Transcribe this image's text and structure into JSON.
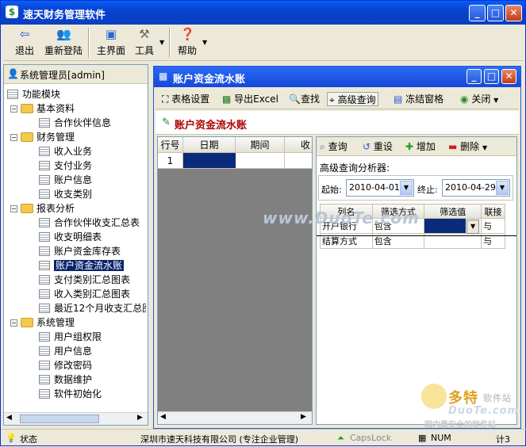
{
  "window": {
    "title": "速天财务管理软件"
  },
  "toolbar": {
    "exit": "退出",
    "relogin": "重新登陆",
    "main": "主界面",
    "tools": "工具",
    "help": "帮助"
  },
  "left": {
    "user": "系统管理员[admin]",
    "modules": "功能模块",
    "g1": "基本资料",
    "g1a": "合作伙伴信息",
    "g2": "财务管理",
    "g2a": "收入业务",
    "g2b": "支付业务",
    "g2c": "账户信息",
    "g2d": "收支类别",
    "g3": "报表分析",
    "g3a": "合作伙伴收支汇总表",
    "g3b": "收支明细表",
    "g3c": "账户资金库存表",
    "g3d": "账户资金流水账",
    "g3e": "支付类别汇总图表",
    "g3f": "收入类别汇总图表",
    "g3g": "最近12个月收支汇总图",
    "g4": "系统管理",
    "g4a": "用户组权限",
    "g4b": "用户信息",
    "g4c": "修改密码",
    "g4d": "数据维护",
    "g4e": "软件初始化"
  },
  "child": {
    "title": "账户资金流水账",
    "header": "账户资金流水账"
  },
  "ctoolbar": {
    "grid": "表格设置",
    "excel": "导出Excel",
    "find": "查找",
    "adv": "高级查询",
    "freeze": "冻结窗格",
    "close": "关闭"
  },
  "grid": {
    "h0": "行号",
    "h1": "日期",
    "h2": "期间",
    "h3": "收",
    "row1": "1"
  },
  "query": {
    "q": "查询",
    "reset": "重设",
    "add": "增加",
    "del": "删除",
    "label": "高级查询分析器:",
    "start_label": "起始:",
    "start": "2010-04-01",
    "end_label": "终止:",
    "end": "2010-04-29",
    "col_name": "列名",
    "col_mode": "筛选方式",
    "col_val": "筛选值",
    "col_link": "联接",
    "r1_name": "开户银行",
    "r1_mode": "包含",
    "r1_link": "与",
    "r2_name": "结算方式",
    "r2_mode": "包含",
    "r2_link": "与"
  },
  "status": {
    "state": "状态",
    "company": "深圳市速天科技有限公司 (专注企业管理)",
    "caps": "CapsLock",
    "num": "NUM",
    "time": "计3"
  },
  "watermark": {
    "w1": "www.DuoTe.com",
    "w2": "多特",
    "w2b": "软件站",
    "w3": "DuoTe.com",
    "w4": "国内最安全的软件站"
  }
}
